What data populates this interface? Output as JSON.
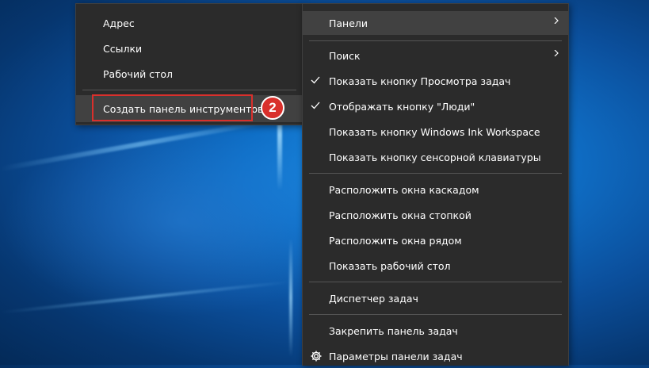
{
  "toolbars_submenu": {
    "items": [
      {
        "label": "Адрес"
      },
      {
        "label": "Ссылки"
      },
      {
        "label": "Рабочий стол"
      }
    ],
    "new_toolbar_label": "Создать панель инструментов...",
    "step_badge": "2"
  },
  "taskbar_menu": {
    "toolbars_label": "Панели",
    "search_label": "Поиск",
    "show_task_view_label": "Показать кнопку Просмотра задач",
    "show_people_label": "Отображать кнопку \"Люди\"",
    "show_ink_label": "Показать кнопку Windows Ink Workspace",
    "show_keyboard_label": "Показать кнопку сенсорной клавиатуры",
    "cascade_label": "Расположить окна каскадом",
    "stacked_label": "Расположить окна стопкой",
    "side_by_side_label": "Расположить окна рядом",
    "show_desktop_label": "Показать рабочий стол",
    "task_manager_label": "Диспетчер задач",
    "lock_taskbar_label": "Закрепить панель задач",
    "taskbar_settings_label": "Параметры панели задач"
  },
  "icons": {
    "arrow": "chevron-right-icon",
    "check": "check-icon",
    "settings": "gear-icon"
  },
  "colors": {
    "menu_bg": "#2b2b2b",
    "menu_hover": "#414141",
    "highlight_red": "#d9302c"
  }
}
